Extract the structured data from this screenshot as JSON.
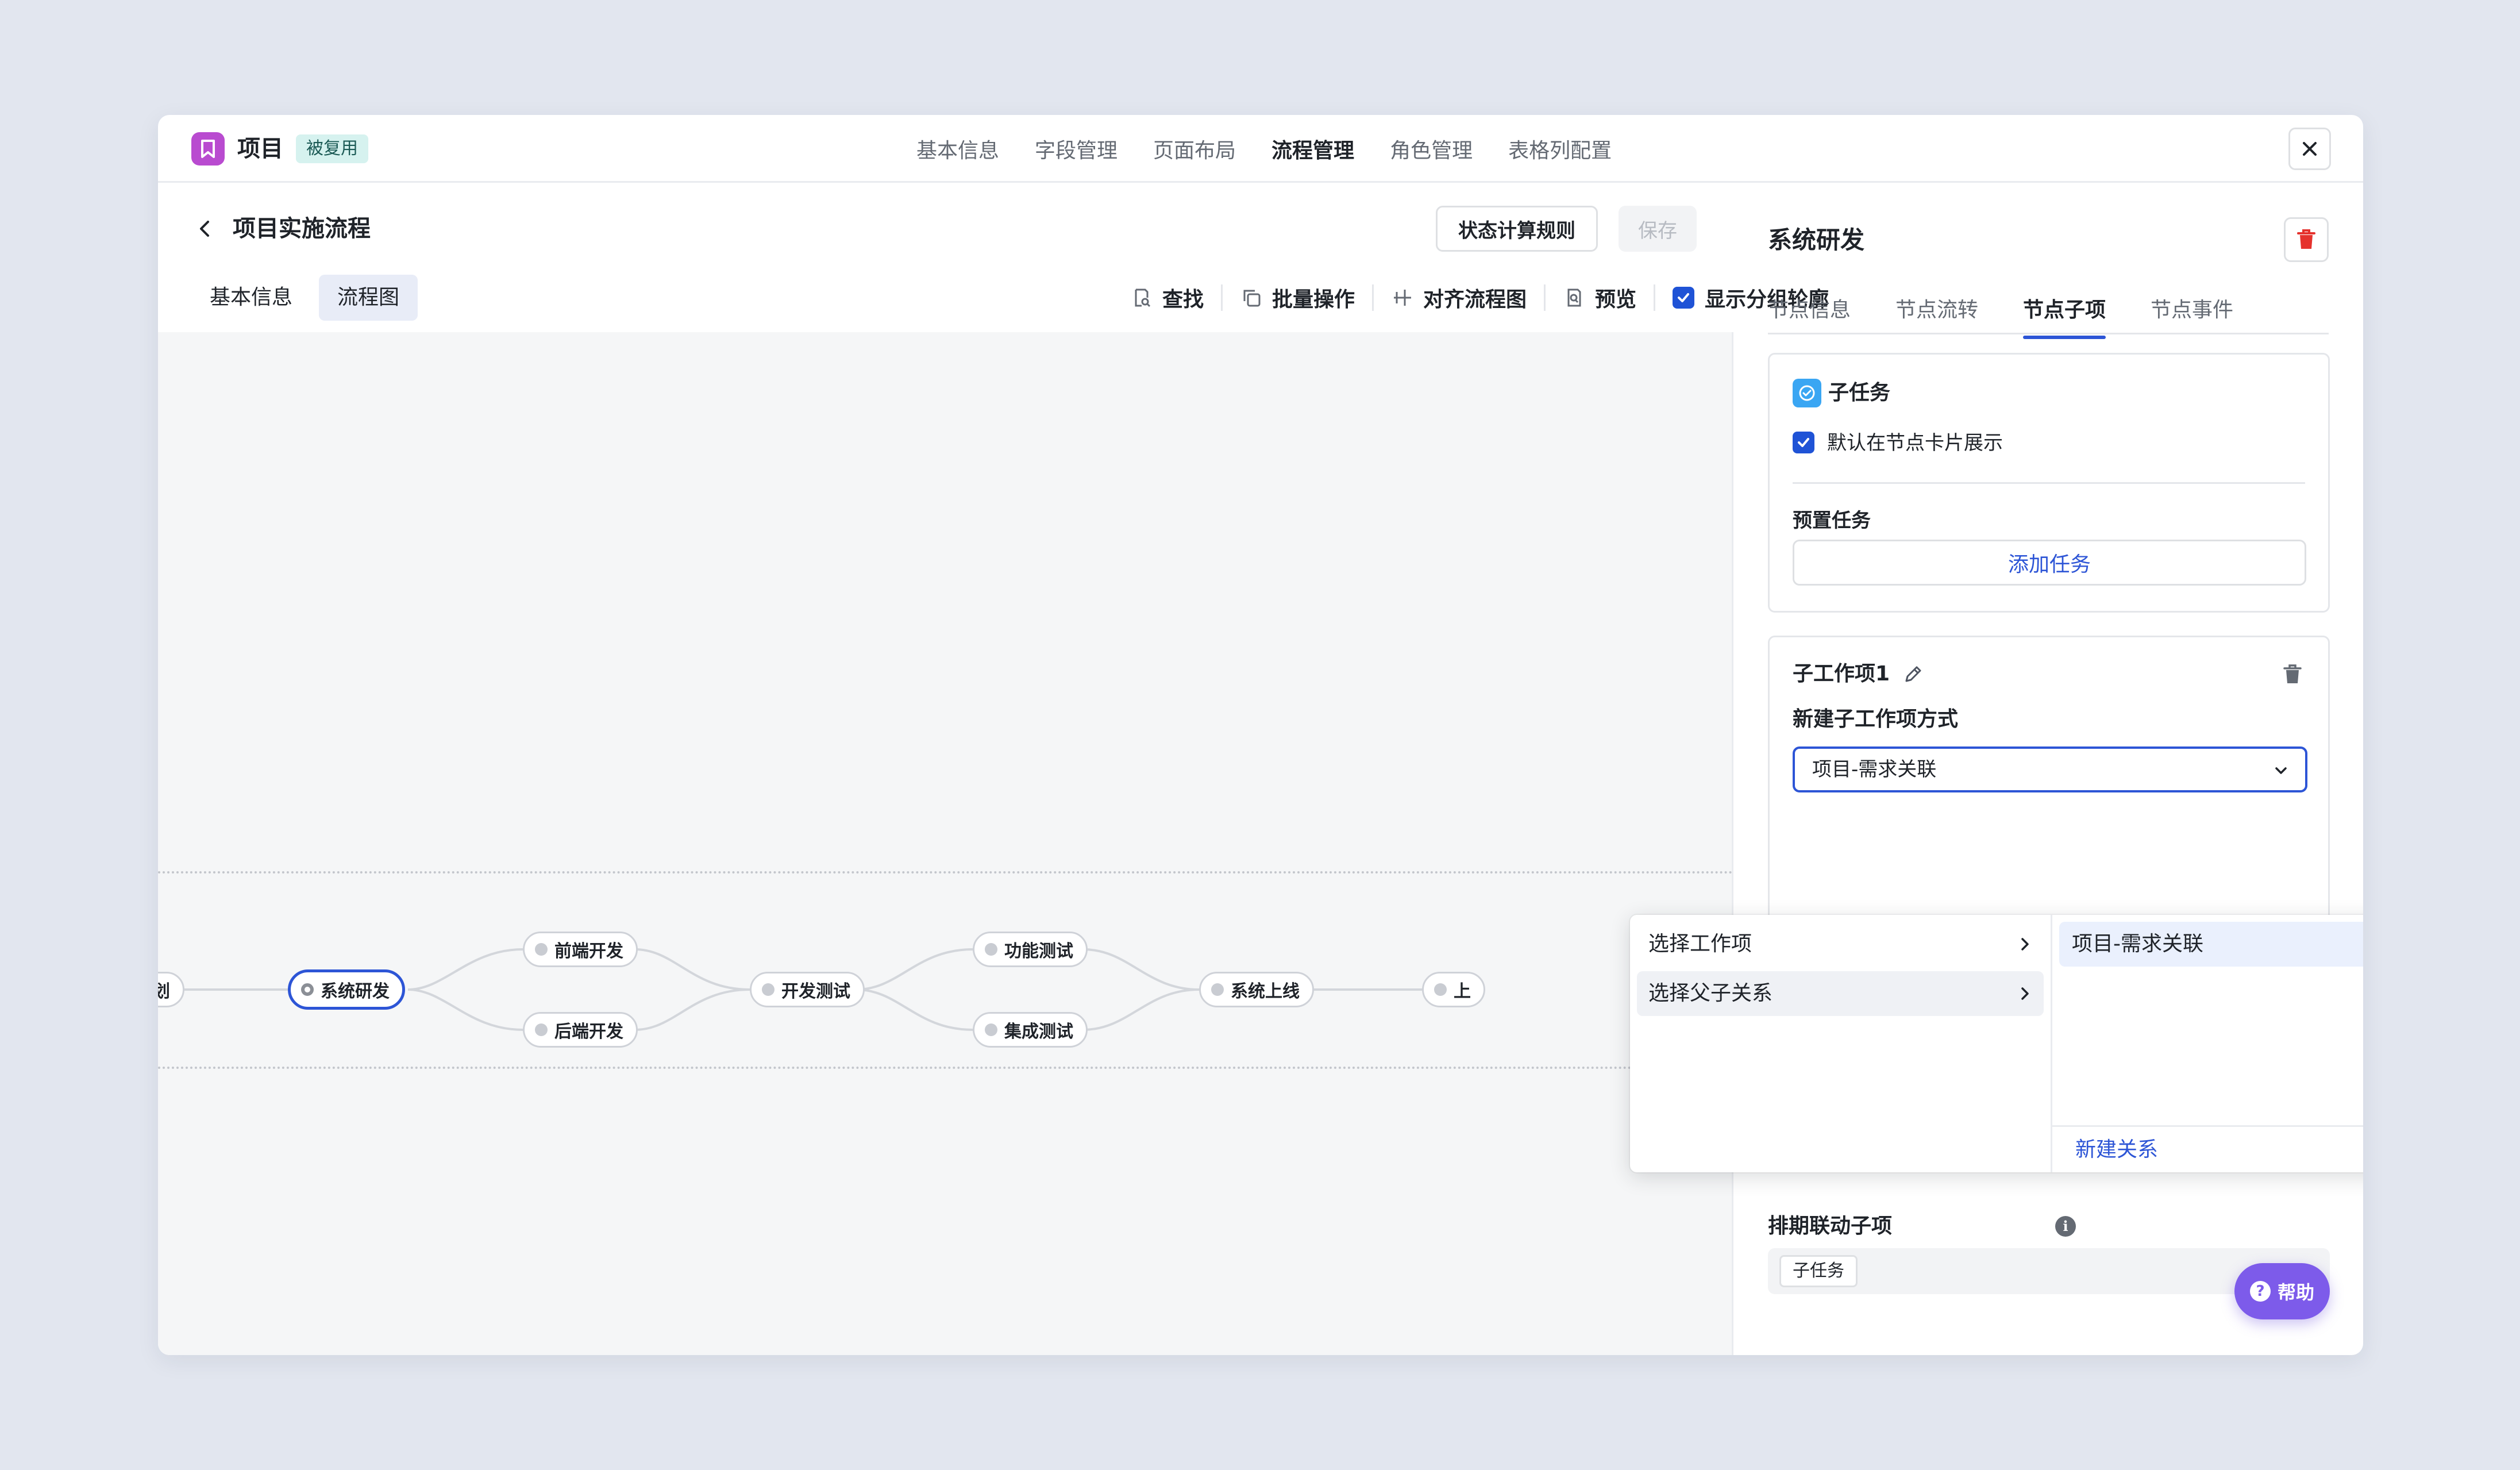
{
  "app": {
    "title": "项目",
    "badge": "被复用"
  },
  "topnav": [
    "基本信息",
    "字段管理",
    "页面布局",
    "流程管理",
    "角色管理",
    "表格列配置"
  ],
  "topnav_active": "流程管理",
  "flow": {
    "title": "项目实施流程",
    "rule_button": "状态计算规则",
    "save_button": "保存",
    "subtabs": [
      "基本信息",
      "流程图"
    ],
    "toolbar": {
      "find": "查找",
      "batch": "批量操作",
      "align": "对齐流程图",
      "preview": "预览",
      "show_group": "显示分组轮廓"
    },
    "nodes": {
      "prev": "划",
      "dev": "系统研发",
      "fe": "前端开发",
      "be": "后端开发",
      "test": "开发测试",
      "func": "功能测试",
      "integ": "集成测试",
      "launch": "系统上线",
      "next": "上"
    }
  },
  "panel": {
    "title": "系统研发",
    "tabs": [
      "节点信息",
      "节点流转",
      "节点子项",
      "节点事件"
    ],
    "active_tab": "节点子项",
    "subtask": {
      "label": "子任务",
      "default_show": "默认在节点卡片展示",
      "preset": "预置任务",
      "add": "添加任务"
    },
    "subitem": {
      "title": "子工作项1",
      "mode_label": "新建子工作项方式",
      "mode_value": "项目-需求关联"
    },
    "schedule": {
      "label": "排期联动子项",
      "tag": "子任务"
    }
  },
  "dropdown": {
    "col1": [
      "选择工作项",
      "选择父子关系"
    ],
    "col2": [
      "项目-需求关联"
    ],
    "new_relation": "新建关系"
  },
  "help": "帮助",
  "colors": {
    "accent": "#2d55d6",
    "danger": "#e5322d",
    "help": "#7d5bea",
    "app_icon": "#b94bd0"
  }
}
